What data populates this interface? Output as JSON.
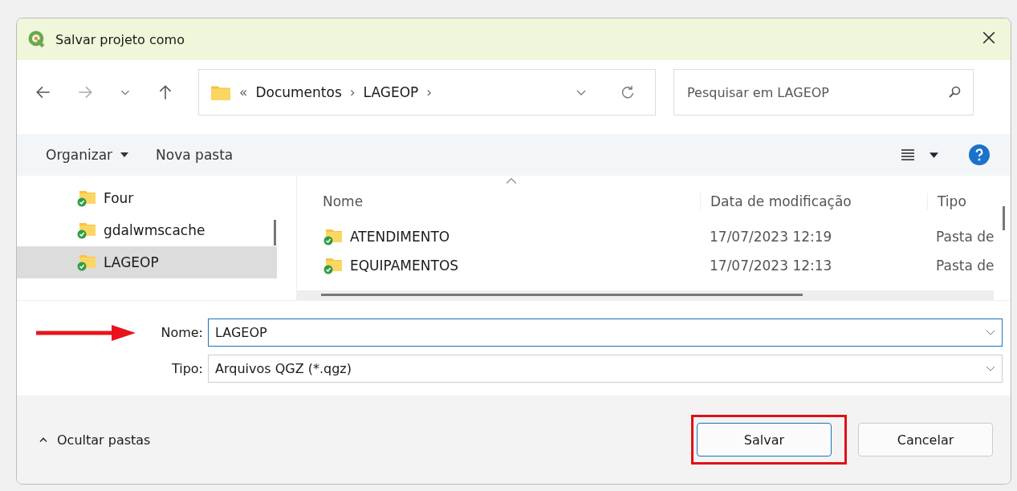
{
  "window": {
    "title": "Salvar projeto como"
  },
  "breadcrumb": {
    "overflow": "«",
    "parts": [
      "Documentos",
      "LAGEOP"
    ],
    "separator": "›"
  },
  "search": {
    "placeholder": "Pesquisar em LAGEOP"
  },
  "toolbar": {
    "organize": "Organizar",
    "new_folder": "Nova pasta"
  },
  "sidebar": {
    "items": [
      {
        "label": "Four",
        "selected": false
      },
      {
        "label": "gdalwmscache",
        "selected": false
      },
      {
        "label": "LAGEOP",
        "selected": true
      }
    ]
  },
  "table": {
    "columns": [
      "Nome",
      "Data de modificação",
      "Tipo"
    ],
    "rows": [
      {
        "name": "ATENDIMENTO",
        "modified": "17/07/2023 12:19",
        "type": "Pasta de"
      },
      {
        "name": "EQUIPAMENTOS",
        "modified": "17/07/2023 12:13",
        "type": "Pasta de"
      }
    ]
  },
  "fields": [
    {
      "label": "Nome:",
      "value": "LAGEOP",
      "focused": true,
      "annotated": true
    },
    {
      "label": "Tipo:",
      "value": "Arquivos QGZ (*.qgz)",
      "focused": false,
      "annotated": false
    }
  ],
  "hide_folders": "Ocultar pastas",
  "buttons": [
    {
      "label": "Salvar",
      "highlighted": true
    },
    {
      "label": "Cancelar",
      "highlighted": false
    }
  ]
}
